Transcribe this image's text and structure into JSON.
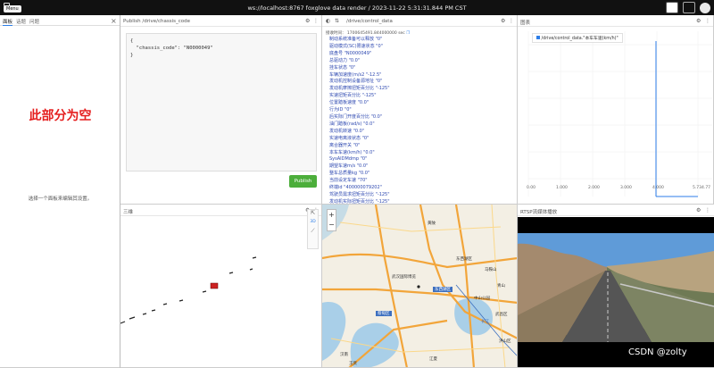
{
  "topbar": {
    "menu": "Menu",
    "title": "ws://localhost:8767 foxglove data render / 2023-11-22 5:31:31.844 PM CST"
  },
  "sidebar": {
    "tabs": [
      "面板",
      "话题",
      "问题"
    ],
    "close": "×",
    "placeholder": "此部分为空",
    "hint": "选择一个面板来编辑其设置。"
  },
  "publish": {
    "title": "Publish /drive/chassis_code",
    "code_lines": [
      "{",
      "  \"chassis_code\": \"N0000049\"",
      "}"
    ],
    "button": "Publish"
  },
  "raw": {
    "title": "/drive/control_data",
    "time": "接收时间： 1700645491.844000000 sec",
    "lines": [
      "制动系统准备可以释放  \"0\"",
      "驱动模式(SC)限速状态  \"0\"",
      "底盘号  \"N0000049\"",
      "总驱动力  \"0.0\"",
      "挂车状态  \"0\"",
      "车辆加速度(m/s2  \"-12.5\"",
      "发动机控制设备源地址  \"0\"",
      "发动机摩擦扭矩百分比  \"-125\"",
      "实速扭矩百分比  \"-125\"",
      "位置踏板速度  \"0.0\"",
      "行为ID  \"0\"",
      "后实际门开度百分比  \"0.0\"",
      "油门踏板(rad/s)  \"0.0\"",
      "发动机转速  \"0.0\"",
      "实速电离液状态  \"0\"",
      "离合器开关  \"0\"",
      "本车车速(km/h)  \"0.0\"",
      "SysAIDMdmp  \"0\"",
      "期望车速m/s  \"0.0\"",
      "整车总质量kg  \"0.0\"",
      "当前设定车速  \"70\"",
      "终端id  \"400000079202\"",
      "驾驶员需求扭矩百分比  \"-125\"",
      "发动机实际扭矩百分比  \"-125\""
    ]
  },
  "plot": {
    "title": "图表",
    "legend": "/drive/control_data.\"本车车速(km/h)\"",
    "x_ticks": [
      "0.00",
      "1.000",
      "2.000",
      "3.000",
      "4.000",
      "5.734.77"
    ],
    "color_series": "#2d7ee8"
  },
  "panel3d": {
    "title": "三维",
    "zoom": "3D"
  },
  "map": {
    "title": "地图",
    "zoom_in": "+",
    "zoom_out": "−",
    "labels": [
      "武汉国际博览",
      "东西湖区",
      "蔡甸区",
      "汉南",
      "长江",
      "东西湖区",
      "青山",
      "武昌区",
      "洪山区",
      "江夏",
      "中山公园",
      "黄陂",
      "马鞍山",
      "玉贤"
    ]
  },
  "camera": {
    "title": "RTSP流媒体播放"
  },
  "watermark": "CSDN @zolty"
}
